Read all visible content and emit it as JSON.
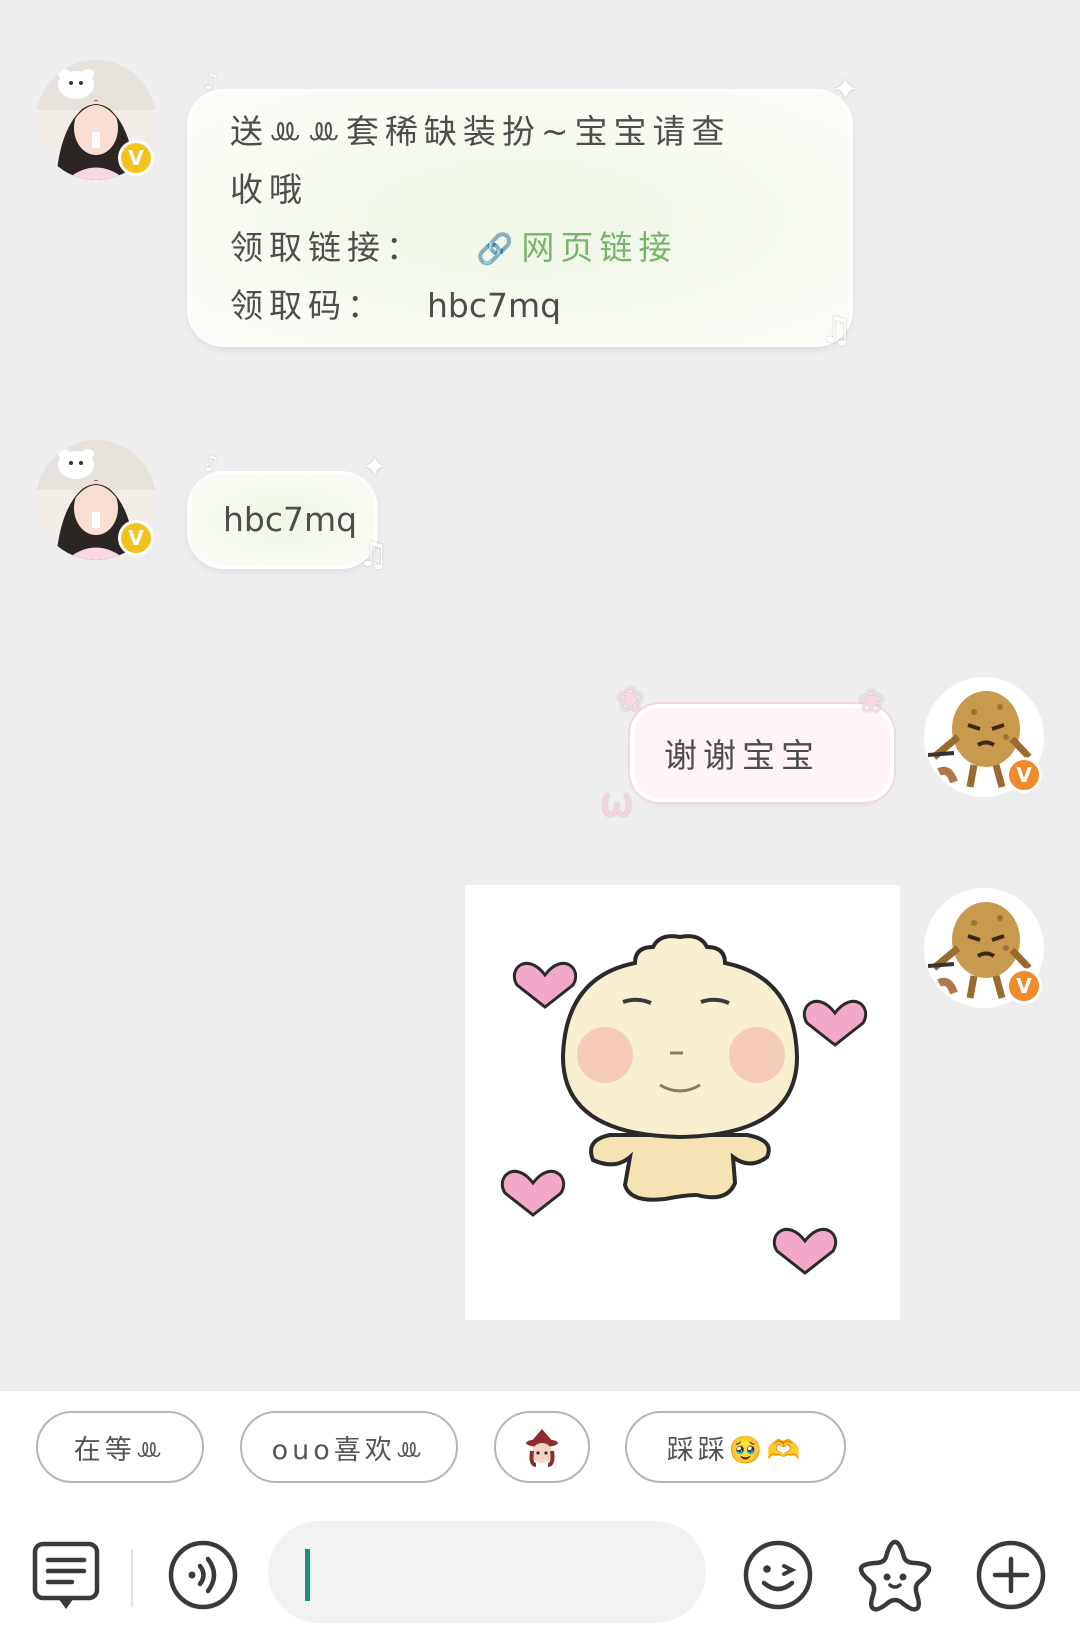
{
  "messages": {
    "m1": {
      "line1": "送ꔛꔛ套稀缺装扮~宝宝请查",
      "line2": "收哦",
      "link_label": "领取链接：",
      "link_text": "网页链接",
      "code_label": "领取码：",
      "code_value": "hbc7mq"
    },
    "m2": {
      "text": "hbc7mq"
    },
    "m3": {
      "text": "谢谢宝宝"
    }
  },
  "badges": {
    "verified": "V"
  },
  "quick_replies": [
    "在等ꔛ",
    "ouo喜欢ꔛ",
    "",
    "踩踩🥹🫶"
  ],
  "colors": {
    "background": "#eeeeee",
    "link_green": "#78b46a",
    "badge_yellow": "#f4c21c",
    "badge_orange": "#f08a2b",
    "caret_teal": "#1f8e7b",
    "heart_pink": "#f3a8c9"
  },
  "icons": {
    "menu": "message-list-icon",
    "voice": "voice-icon",
    "emoji": "emoji-icon",
    "sticker": "star-sticker-icon",
    "plus": "plus-icon",
    "link": "link-icon"
  }
}
